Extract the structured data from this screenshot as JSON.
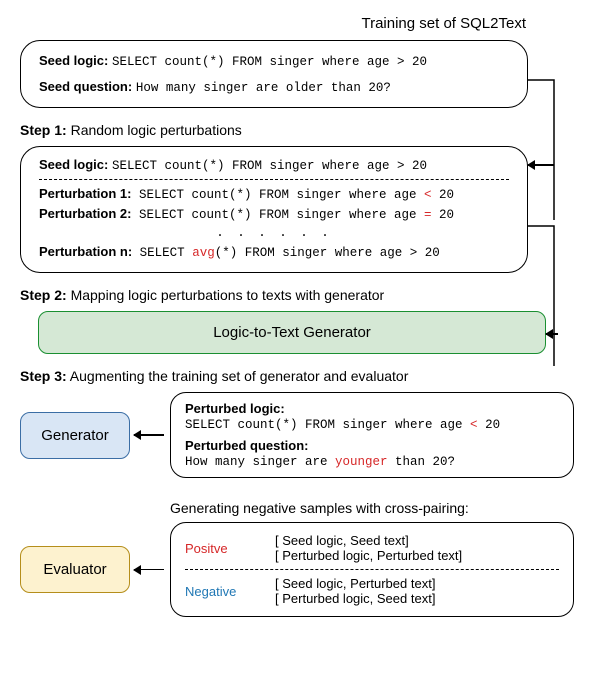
{
  "header": {
    "title": "Training set of  SQL2Text"
  },
  "seedbox": {
    "seed_label": "Seed logic:",
    "seed_sql": "SELECT count(*) FROM singer where age > 20",
    "seed_q_label": "Seed question:",
    "seed_q": "How many singer are older than 20?"
  },
  "step1": {
    "title_b": "Step 1:",
    "title": " Random logic perturbations"
  },
  "pbox": {
    "seed_label": "Seed logic:",
    "seed_sql": "SELECT count(*) FROM singer where age > 20",
    "p1_label": "Perturbation 1:",
    "p1_pre": " SELECT count(*) FROM singer where age ",
    "p1_red": "<",
    "p1_post": " 20",
    "p2_label": "Perturbation 2:",
    "p2_pre": " SELECT count(*) FROM singer where age ",
    "p2_red": "=",
    "p2_post": " 20",
    "dots": ". . . . . .",
    "pn_label": "Perturbation n:",
    "pn_pre": " SELECT ",
    "pn_red": "avg",
    "pn_post": "(*) FROM singer where age > 20"
  },
  "step2": {
    "title_b": "Step 2:",
    "title": " Mapping logic perturbations to texts with generator"
  },
  "gen_bar": {
    "label": "Logic-to-Text Generator"
  },
  "step3": {
    "title_b": "Step 3:",
    "title": " Augmenting the training set of generator and evaluator"
  },
  "generator": {
    "label": "Generator"
  },
  "gen_out": {
    "pl_label": "Perturbed logic:",
    "pl_pre": "SELECT count(*) FROM singer where age ",
    "pl_red": "<",
    "pl_post": " 20",
    "pq_label": "Perturbed question:",
    "pq_pre": "How many singer are ",
    "pq_red": "younger",
    "pq_post": " than 20?"
  },
  "eval_title": "Generating negative samples with cross-pairing:",
  "evaluator": {
    "label": "Evaluator"
  },
  "eval_box": {
    "pos_label": "Positve",
    "pos1": "[ Seed logic,  Seed text]",
    "pos2": "[ Perturbed logic,  Perturbed text]",
    "neg_label": "Negative",
    "neg1": "[ Seed logic, Perturbed text]",
    "neg2": "[ Perturbed logic,  Seed text]"
  }
}
